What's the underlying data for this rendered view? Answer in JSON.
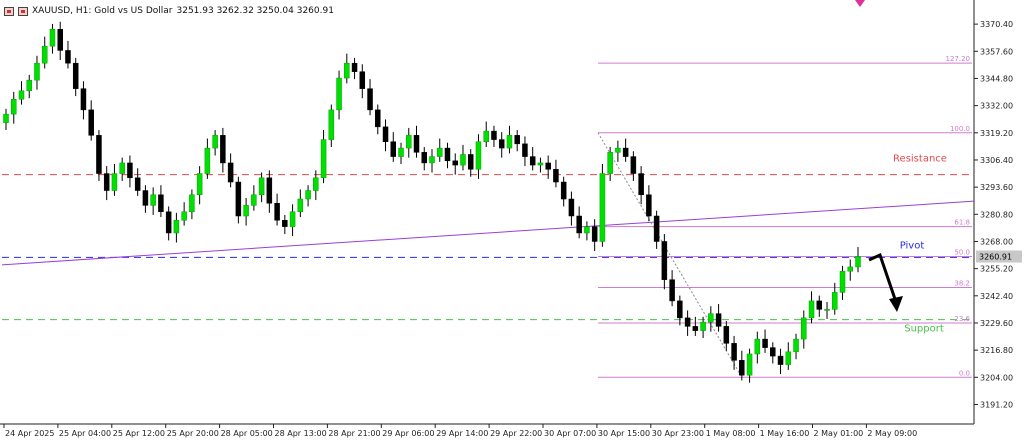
{
  "header": {
    "symbol": "XAUUSD, H1: Gold vs US Dollar",
    "ohlc": "3251.93 3262.32 3250.04 3260.91",
    "icons": [
      "window-restore-icon",
      "window-close-icon"
    ]
  },
  "chart_data": {
    "type": "candlestick",
    "title": "XAUUSD, H1: Gold vs US Dollar",
    "symbol": "XAUUSD",
    "timeframe": "H1",
    "ohlc_current": {
      "open": 3251.93,
      "high": 3262.32,
      "low": 3250.04,
      "close": 3260.91
    },
    "current_price": "3260.91",
    "ylim": [
      3182,
      3378
    ],
    "y_ticks": [
      "3370.40",
      "3357.60",
      "3344.80",
      "3332.00",
      "3319.20",
      "3306.40",
      "3293.60",
      "3280.80",
      "3268.00",
      "3255.20",
      "3242.40",
      "3229.60",
      "3216.80",
      "3204.00",
      "3191.20"
    ],
    "x_ticks": [
      "24 Apr 2025",
      "25 Apr 04:00",
      "25 Apr 12:00",
      "25 Apr 20:00",
      "28 Apr 05:00",
      "28 Apr 13:00",
      "28 Apr 21:00",
      "29 Apr 06:00",
      "29 Apr 14:00",
      "29 Apr 22:00",
      "30 Apr 07:00",
      "30 Apr 15:00",
      "30 Apr 23:00",
      "1 May 08:00",
      "1 May 16:00",
      "2 May 01:00",
      "2 May 09:00"
    ],
    "closes": [
      3328,
      3335,
      3339,
      3344,
      3352,
      3360,
      3368,
      3358,
      3352,
      3340,
      3330,
      3318,
      3300,
      3292,
      3300,
      3305,
      3298,
      3292,
      3285,
      3290,
      3282,
      3272,
      3278,
      3282,
      3290,
      3300,
      3312,
      3318,
      3305,
      3296,
      3280,
      3285,
      3290,
      3298,
      3286,
      3278,
      3275,
      3282,
      3288,
      3292,
      3298,
      3316,
      3330,
      3345,
      3352,
      3348,
      3340,
      3330,
      3322,
      3315,
      3308,
      3312,
      3318,
      3310,
      3305,
      3308,
      3312,
      3306,
      3304,
      3309,
      3302,
      3315,
      3320,
      3316,
      3312,
      3318,
      3314,
      3308,
      3304,
      3305,
      3302,
      3296,
      3288,
      3280,
      3272,
      3275,
      3268,
      3300,
      3310,
      3312,
      3308,
      3300,
      3290,
      3280,
      3268,
      3250,
      3240,
      3232,
      3228,
      3226,
      3230,
      3234,
      3228,
      3220,
      3212,
      3205,
      3215,
      3222,
      3218,
      3214,
      3210,
      3216,
      3222,
      3232,
      3240,
      3236,
      3236,
      3244,
      3254,
      3256,
      3260.91
    ],
    "fib_levels": [
      {
        "label": "127.20",
        "price": 3352
      },
      {
        "label": "100.0",
        "price": 3319.2
      },
      {
        "label": "61.8",
        "price": 3275
      },
      {
        "label": "50.0",
        "price": 3260.9
      },
      {
        "label": "38.2",
        "price": 3246.3
      },
      {
        "label": "23.6",
        "price": 3229.6
      },
      {
        "label": "0.0",
        "price": 3204
      }
    ],
    "horizontal_lines": [
      {
        "label": "Resistance",
        "price": 3299.5,
        "color": "#e04a4a"
      },
      {
        "label": "Pivot",
        "price": 3260.5,
        "color": "#2a2ae8"
      },
      {
        "label": "Support",
        "price": 3231.2,
        "color": "#49c049"
      }
    ],
    "trendline": {
      "color": "#9a3fd6",
      "start_price": 3257,
      "end_price": 3287
    },
    "colors": {
      "bull": "#00e000",
      "bear": "#000000",
      "fib": "#d07ad0",
      "axis": "#222222",
      "price_label_bg": "#c8c8c8"
    }
  }
}
